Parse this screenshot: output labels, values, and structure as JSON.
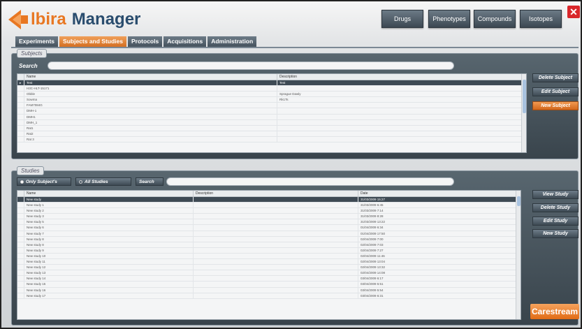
{
  "app": {
    "title_part1": "lbira",
    "title_part2": "Manager",
    "brand": "Carestream",
    "accent_orange": "#e87722",
    "accent_blue": "#2a4d6e"
  },
  "topbar": {
    "buttons": [
      {
        "label": "Drugs"
      },
      {
        "label": "Phenotypes"
      },
      {
        "label": "Compounds"
      },
      {
        "label": "Isotopes"
      }
    ]
  },
  "tabs": [
    {
      "label": "Experiments"
    },
    {
      "label": "Subjects and Studies"
    },
    {
      "label": "Protocols"
    },
    {
      "label": "Acquisitions"
    },
    {
      "label": "Administration"
    }
  ],
  "subjects": {
    "legend": "Subjects",
    "search_label": "Search",
    "search_value": "",
    "columns": [
      "Name",
      "Description"
    ],
    "rows": [
      [
        "Test",
        "Test"
      ],
      [
        "H3C-HLT-15171",
        ""
      ],
      [
        "Obble",
        "Sprague Dawly"
      ],
      [
        "Sowma",
        "Rk1Ts"
      ],
      [
        "FAM7084G",
        ""
      ],
      [
        "DMH-1",
        ""
      ],
      [
        "DMH1",
        ""
      ],
      [
        "DMH_1",
        ""
      ],
      [
        "Rat1",
        ""
      ],
      [
        "Rat2",
        ""
      ],
      [
        "Rat 3",
        ""
      ]
    ],
    "buttons": {
      "delete": "Delete Subject",
      "edit": "Edit Subject",
      "new": "New Subject"
    }
  },
  "studies": {
    "legend": "Studies",
    "filter_only": "Only Subject's",
    "filter_all": "All Studies",
    "search_label": "Search",
    "search_value": "",
    "columns": [
      "Name",
      "Description",
      "Date"
    ],
    "rows": [
      [
        "New study",
        "",
        "31/03/2009 15:27"
      ],
      [
        "New study 1",
        "",
        "31/03/2009 6:45"
      ],
      [
        "New study 2",
        "",
        "31/03/2009 7:14"
      ],
      [
        "New study 3",
        "",
        "31/03/2009 8:28"
      ],
      [
        "New study 5",
        "",
        "31/03/2009 13:22"
      ],
      [
        "New study 6",
        "",
        "01/04/2009 6:34"
      ],
      [
        "New study 7",
        "",
        "01/04/2009 17:50"
      ],
      [
        "New study 8",
        "",
        "02/04/2009 7:00"
      ],
      [
        "New study 8",
        "",
        "02/04/2009 7:03"
      ],
      [
        "New study 9",
        "",
        "02/04/2009 7:27"
      ],
      [
        "New study 10",
        "",
        "02/04/2009 11:46"
      ],
      [
        "New study 11",
        "",
        "02/04/2009 13:04"
      ],
      [
        "New study 12",
        "",
        "02/04/2009 13:32"
      ],
      [
        "New study 13",
        "",
        "02/04/2009 14:08"
      ],
      [
        "New study 14",
        "",
        "03/04/2009 6:17"
      ],
      [
        "New study 15",
        "",
        "03/04/2009 5:51"
      ],
      [
        "New study 16",
        "",
        "03/04/2009 5:54"
      ],
      [
        "New study 17",
        "",
        "03/04/2009 6:31"
      ]
    ],
    "buttons": {
      "view": "View Study",
      "delete": "Delete Study",
      "edit": "Edit Study",
      "new": "New Study"
    }
  },
  "icons": {
    "close": "close-icon",
    "logo": "logo-arrow-icon"
  }
}
